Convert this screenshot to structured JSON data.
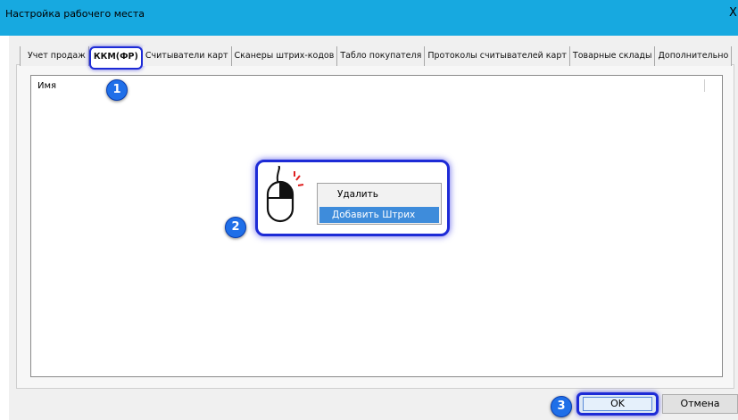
{
  "window": {
    "title": "Настройка рабочего места",
    "close_glyph": "X"
  },
  "tabs": [
    {
      "label": "Учет продаж",
      "active": false
    },
    {
      "label": "ККМ(ФР)",
      "active": true
    },
    {
      "label": "Считыватели карт",
      "active": false
    },
    {
      "label": "Сканеры штрих-кодов",
      "active": false
    },
    {
      "label": "Табло покупателя",
      "active": false
    },
    {
      "label": "Протоколы считывателей карт",
      "active": false
    },
    {
      "label": "Товарные склады",
      "active": false
    },
    {
      "label": "Дополнительно",
      "active": false
    }
  ],
  "list": {
    "column_header": "Имя"
  },
  "context_menu": {
    "items": [
      {
        "label": "Удалить",
        "selected": false
      },
      {
        "label": "Добавить Штрих",
        "selected": true
      }
    ]
  },
  "annotations": {
    "step1": "1",
    "step2": "2",
    "step3": "3"
  },
  "buttons": {
    "ok_label": "OK",
    "cancel_label": "Отмена"
  },
  "icons": {
    "mouse": "mouse-right-click-icon"
  },
  "colors": {
    "titlebar": "#17a9e0",
    "highlight": "#1d2bd6",
    "badge": "#1f6fe8",
    "menu_selection": "#3e8cdb"
  }
}
